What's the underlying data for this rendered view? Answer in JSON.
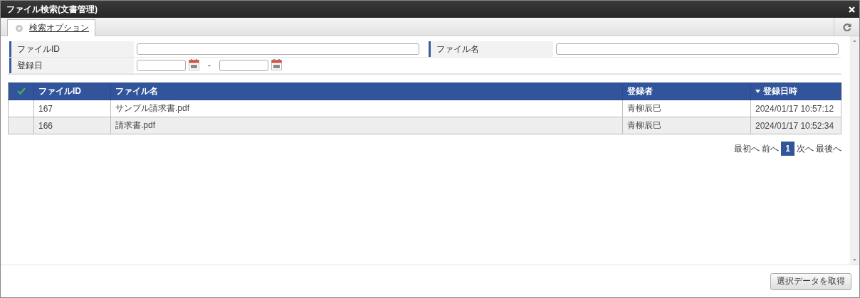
{
  "window": {
    "title": "ファイル検索(文書管理)"
  },
  "tabs": [
    {
      "label": "検索オプション",
      "selected": true
    }
  ],
  "search": {
    "fields": [
      {
        "label": "ファイルID",
        "kind": "text"
      },
      {
        "label": "ファイル名",
        "kind": "text"
      },
      {
        "label": "登録日",
        "kind": "daterange",
        "separator": "-"
      }
    ]
  },
  "table": {
    "select_all": false,
    "columns": [
      {
        "label": "ファイルID",
        "sorted_descending": false
      },
      {
        "label": "ファイル名",
        "sorted_descending": false
      },
      {
        "label": "登録者",
        "sorted_descending": false
      },
      {
        "label": "登録日時",
        "sorted_descending": true
      }
    ],
    "rows": [
      {
        "selected": false,
        "cells": [
          "167",
          "サンプル請求書.pdf",
          "青柳辰巳",
          "2024/01/17 10:57:12"
        ]
      },
      {
        "selected": false,
        "cells": [
          "166",
          "請求書.pdf",
          "青柳辰巳",
          "2024/01/17 10:52:34"
        ]
      }
    ]
  },
  "pagination": {
    "first": "最初へ",
    "prev": "前へ",
    "pages": [
      {
        "label": "1",
        "selected": true
      }
    ],
    "next": "次へ",
    "last": "最後へ"
  },
  "buttons": [
    "選択データを取得"
  ]
}
